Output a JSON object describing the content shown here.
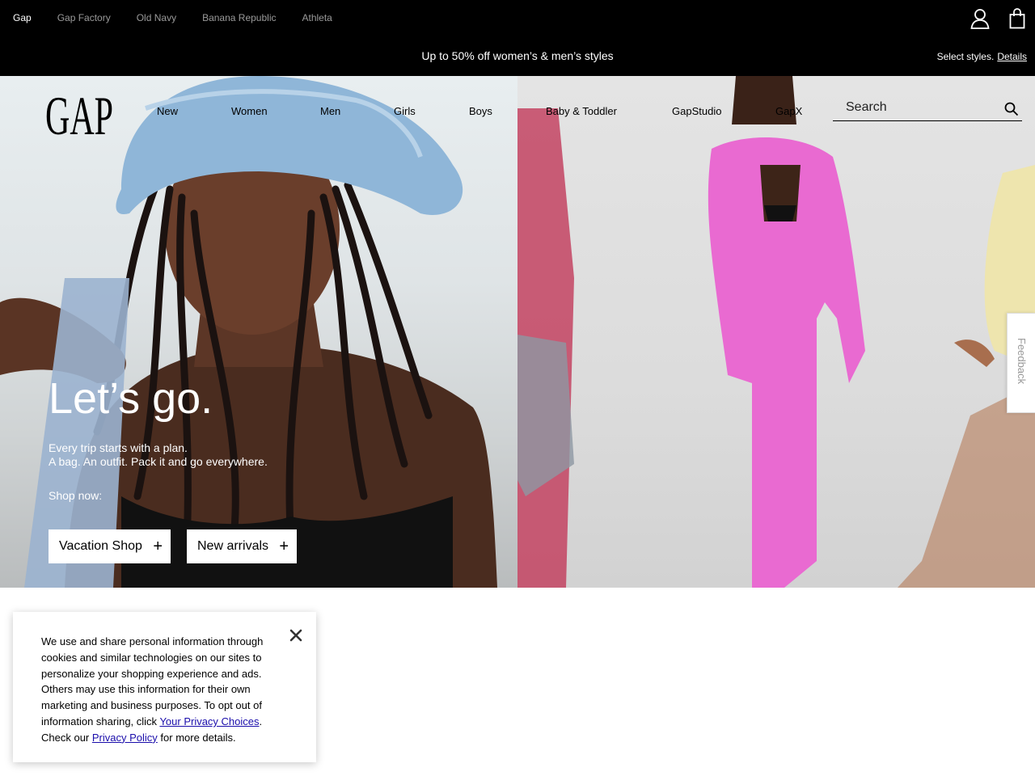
{
  "brands": [
    "Gap",
    "Gap Factory",
    "Old Navy",
    "Banana Republic",
    "Athleta"
  ],
  "promo": {
    "text": "Up to 50% off women’s & men’s styles",
    "right_text": "Select styles.",
    "details_link": "Details"
  },
  "logo_text": "GAP",
  "nav": [
    "New",
    "Women",
    "Men",
    "Girls",
    "Boys",
    "Baby & Toddler",
    "GapStudio",
    "GapX"
  ],
  "search": {
    "placeholder": "Search"
  },
  "hero": {
    "headline": "Let’s go.",
    "sub_line1": "Every trip starts with a plan.",
    "sub_line2": "A bag. An outfit. Pack it and go everywhere.",
    "shop_now": "Shop now:",
    "buttons": [
      "Vacation Shop",
      "New arrivals"
    ]
  },
  "feedback_label": "Feedback",
  "cookie": {
    "text_before": "We use and share personal information through cookies and similar technologies on our sites to personalize your shopping experience and ads. Others may use this information for their own marketing and business purposes. To opt out of information sharing, click ",
    "link1": "Your Privacy Choices",
    "text_middle": ". Check our ",
    "link2": "Privacy Policy",
    "text_after": " for more details."
  },
  "icons": {
    "account": "user-icon",
    "bag": "shopping-bag-icon",
    "search": "search-icon",
    "close": "close-icon",
    "plus": "plus-icon"
  },
  "colors": {
    "topbar": "#000000",
    "brand_inactive": "#9a9a9a",
    "link": "#1a0dab",
    "pink": "#e96ad1"
  }
}
